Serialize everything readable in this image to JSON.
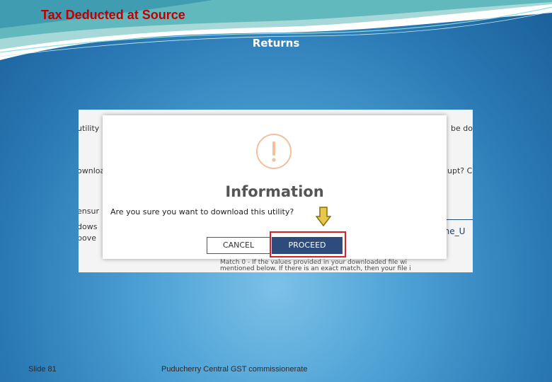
{
  "slide": {
    "title": "Tax Deducted at Source",
    "subtitle": "Returns",
    "footer_left": "Slide 81",
    "footer_center": "Puducherry Central GST commissionerate"
  },
  "background_page": {
    "fragments": [
      "utility",
      "be do",
      "ownloa",
      "upt? Cl",
      "ensur",
      "dows",
      "bove",
      "line_U",
      "Match 0 - If the values provided in your downloaded file wi",
      "mentioned below. If there is an exact match, then your file i"
    ]
  },
  "dialog": {
    "icon": "exclamation-circle-icon",
    "heading": "Information",
    "question": "Are you sure you want to download this utility?",
    "cancel_label": "CANCEL",
    "proceed_label": "PROCEED"
  },
  "annotation": {
    "arrow": "down-arrow-icon",
    "highlight_color": "#d8202a",
    "arrow_color": "#c9a417"
  },
  "colors": {
    "title": "#c00000",
    "proceed_button": "#2d4b7c",
    "icon_ring": "#f0c19c"
  }
}
